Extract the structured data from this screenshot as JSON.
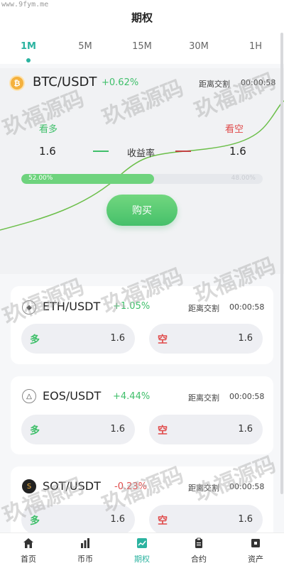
{
  "watermark_url": "www.9fym.me",
  "title": "期权",
  "tabs": [
    {
      "label": "1M",
      "active": true
    },
    {
      "label": "5M",
      "active": false
    },
    {
      "label": "15M",
      "active": false
    },
    {
      "label": "30M",
      "active": false
    },
    {
      "label": "1H",
      "active": false
    }
  ],
  "main": {
    "icon": "bitcoin-icon",
    "icon_glyph": "₿",
    "pair": "BTC/USDT",
    "change": "+0.62%",
    "countdown_label": "距离交割",
    "countdown": "00:00:58",
    "look_up": "看多",
    "look_down": "看空",
    "rate_left": "1.6",
    "rate_label": "收益率",
    "rate_right": "1.6",
    "progress_fraction": 0.55,
    "progress_text": "52.00%",
    "progress_right_text": "48.00%",
    "buy_label": "购买"
  },
  "cards": [
    {
      "icon": "ethereum-icon",
      "glyph": "◆",
      "pair": "ETH/USDT",
      "change": "+1.05%",
      "change_color": "#3fbf6a",
      "countdown_label": "距离交割",
      "countdown": "00:00:58",
      "long_label": "多",
      "long_val": "1.6",
      "short_label": "空",
      "short_val": "1.6"
    },
    {
      "icon": "eos-icon",
      "glyph": "△",
      "pair": "EOS/USDT",
      "change": "+4.44%",
      "change_color": "#3fbf6a",
      "countdown_label": "距离交割",
      "countdown": "00:00:58",
      "long_label": "多",
      "long_val": "1.6",
      "short_label": "空",
      "short_val": "1.6"
    },
    {
      "icon": "sot-icon",
      "glyph": "S",
      "pair": "SOT/USDT",
      "change": "-0.23%",
      "change_color": "#e04a4a",
      "countdown_label": "距离交割",
      "countdown": "00:00:58",
      "long_label": "多",
      "long_val": "1.6",
      "short_label": "空",
      "short_val": "1.6"
    }
  ],
  "watermark_text": "玖福源码",
  "nav": [
    {
      "label": "首页",
      "icon": "home-icon",
      "active": false
    },
    {
      "label": "币币",
      "icon": "bar-chart-icon",
      "active": false
    },
    {
      "label": "期权",
      "icon": "trend-icon",
      "active": true
    },
    {
      "label": "合约",
      "icon": "clipboard-icon",
      "active": false
    },
    {
      "label": "资产",
      "icon": "wallet-icon",
      "active": false
    }
  ],
  "colors": {
    "accent": "#2bb3a0",
    "up": "#3fbf6a",
    "down": "#e04a4a"
  }
}
